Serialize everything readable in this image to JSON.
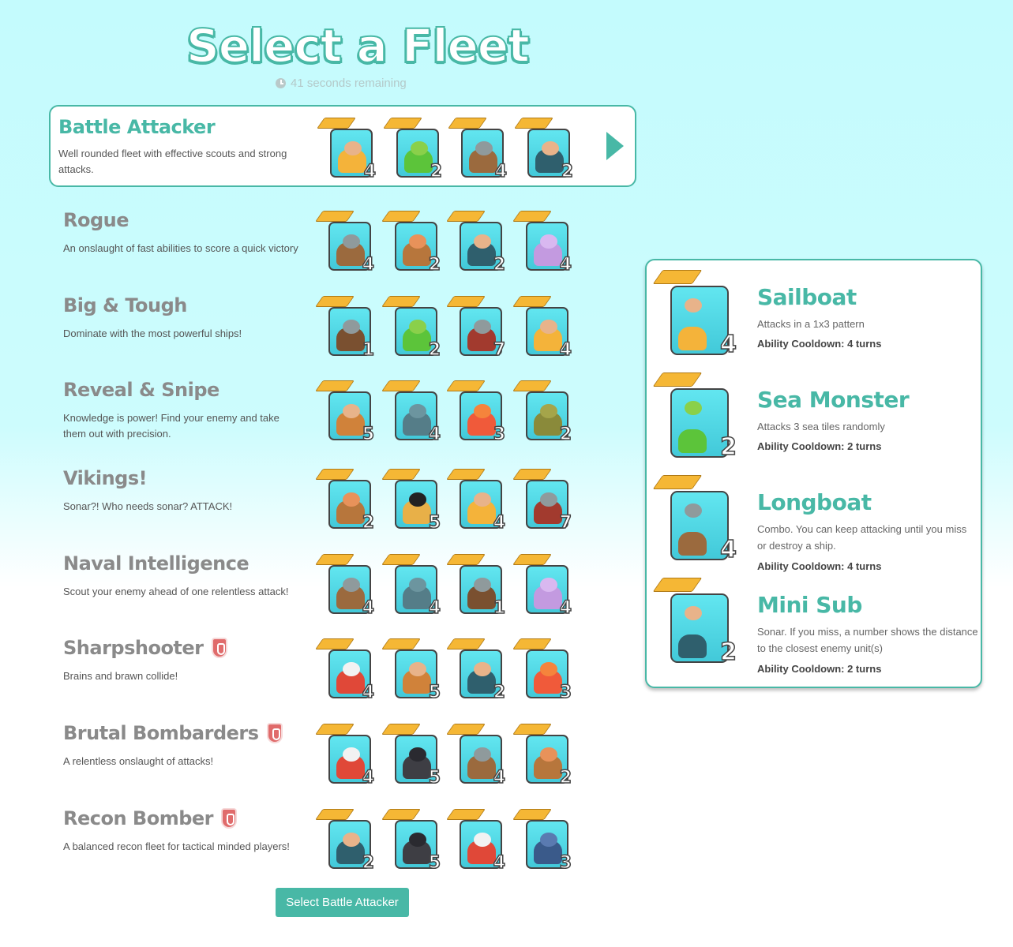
{
  "title": "Select a Fleet",
  "timer": "41 seconds remaining",
  "colors": {
    "accent": "#48b8a6",
    "card_bg": "#4fd8e4",
    "pattern": "#f5b735",
    "restricted": "#e06b6b"
  },
  "fleets": [
    {
      "name": "Battle Attacker",
      "desc": "Well rounded fleet with effective scouts and strong attacks.",
      "selected": true,
      "restricted": false,
      "ships": [
        {
          "kind": "sailboat",
          "count": "4"
        },
        {
          "kind": "sea-monster",
          "count": "2"
        },
        {
          "kind": "longboat",
          "count": "4"
        },
        {
          "kind": "mini-sub",
          "count": "2"
        }
      ]
    },
    {
      "name": "Rogue",
      "desc": "An onslaught of fast abilities to score a quick victory",
      "selected": false,
      "restricted": false,
      "ships": [
        {
          "kind": "longboat",
          "count": "4"
        },
        {
          "kind": "rower",
          "count": "2"
        },
        {
          "kind": "mini-sub",
          "count": "2"
        },
        {
          "kind": "octopus",
          "count": "4"
        }
      ]
    },
    {
      "name": "Big & Tough",
      "desc": "Dominate with the most powerful ships!",
      "selected": false,
      "restricted": false,
      "ships": [
        {
          "kind": "viking",
          "count": "1"
        },
        {
          "kind": "sea-monster",
          "count": "2"
        },
        {
          "kind": "warship",
          "count": "7"
        },
        {
          "kind": "sailboat",
          "count": "4"
        }
      ]
    },
    {
      "name": "Reveal & Snipe",
      "desc": "Knowledge is power! Find your enemy and take them out with precision.",
      "selected": false,
      "restricted": false,
      "ships": [
        {
          "kind": "raft",
          "count": "5"
        },
        {
          "kind": "whale",
          "count": "4"
        },
        {
          "kind": "squid",
          "count": "3"
        },
        {
          "kind": "turtle",
          "count": "2"
        }
      ]
    },
    {
      "name": "Vikings!",
      "desc": "Sonar?! Who needs sonar? ATTACK!",
      "selected": false,
      "restricted": false,
      "ships": [
        {
          "kind": "rower",
          "count": "2"
        },
        {
          "kind": "pirate-flag",
          "count": "5"
        },
        {
          "kind": "sailboat",
          "count": "4"
        },
        {
          "kind": "warship",
          "count": "7"
        }
      ]
    },
    {
      "name": "Naval Intelligence",
      "desc": "Scout your enemy ahead of one relentless attack!",
      "selected": false,
      "restricted": false,
      "ships": [
        {
          "kind": "longboat",
          "count": "4"
        },
        {
          "kind": "whale",
          "count": "4"
        },
        {
          "kind": "viking",
          "count": "1"
        },
        {
          "kind": "octopus",
          "count": "4"
        }
      ]
    },
    {
      "name": "Sharpshooter",
      "desc": "Brains and brawn collide!",
      "selected": false,
      "restricted": true,
      "ships": [
        {
          "kind": "crab",
          "count": "4"
        },
        {
          "kind": "raft",
          "count": "5"
        },
        {
          "kind": "mini-sub",
          "count": "2"
        },
        {
          "kind": "squid",
          "count": "3"
        }
      ]
    },
    {
      "name": "Brutal Bombarders",
      "desc": "A relentless onslaught of attacks!",
      "selected": false,
      "restricted": true,
      "ships": [
        {
          "kind": "crab",
          "count": "4"
        },
        {
          "kind": "pirate",
          "count": "5"
        },
        {
          "kind": "longboat",
          "count": "4"
        },
        {
          "kind": "rower",
          "count": "2"
        }
      ]
    },
    {
      "name": "Recon Bomber",
      "desc": "A balanced recon fleet for tactical minded players!",
      "selected": false,
      "restricted": true,
      "ships": [
        {
          "kind": "mini-sub",
          "count": "2"
        },
        {
          "kind": "pirate",
          "count": "5"
        },
        {
          "kind": "crab",
          "count": "4"
        },
        {
          "kind": "serpent",
          "count": "3"
        }
      ]
    }
  ],
  "details": [
    {
      "name": "Sailboat",
      "kind": "sailboat",
      "count": "4",
      "desc": "Attacks in a 1x3 pattern",
      "cooldown": "Ability Cooldown: 4 turns"
    },
    {
      "name": "Sea Monster",
      "kind": "sea-monster",
      "count": "2",
      "desc": "Attacks 3 sea tiles randomly",
      "cooldown": "Ability Cooldown: 2 turns"
    },
    {
      "name": "Longboat",
      "kind": "longboat",
      "count": "4",
      "desc": "Combo. You can keep attacking until you miss or destroy a ship.",
      "cooldown": "Ability Cooldown: 4 turns"
    },
    {
      "name": "Mini Sub",
      "kind": "mini-sub",
      "count": "2",
      "desc": "Sonar. If you miss, a number shows the distance to the closest enemy unit(s)",
      "cooldown": "Ability Cooldown: 2 turns"
    }
  ],
  "button": {
    "label": "Select Battle Attacker"
  }
}
